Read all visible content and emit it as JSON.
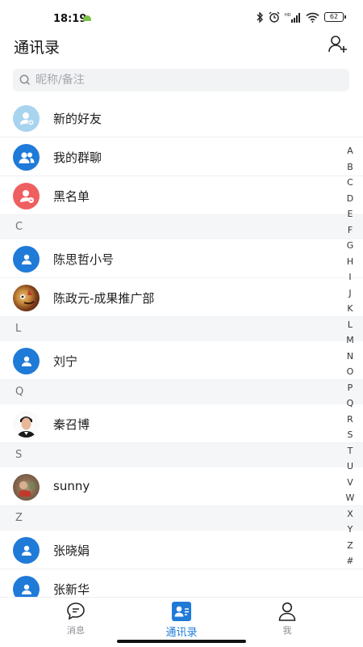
{
  "status_bar": {
    "time": "18:19",
    "battery": "62"
  },
  "header": {
    "title": "通讯录"
  },
  "search": {
    "placeholder": "昵称/备注"
  },
  "quick_entries": [
    {
      "label": "新的好友",
      "icon": "new-friend-icon"
    },
    {
      "label": "我的群聊",
      "icon": "group-chat-icon"
    },
    {
      "label": "黑名单",
      "icon": "blacklist-icon"
    }
  ],
  "sections": [
    {
      "letter": "C",
      "contacts": [
        "陈思哲小号",
        "陈政元-成果推广部"
      ]
    },
    {
      "letter": "L",
      "contacts": [
        "刘宁"
      ]
    },
    {
      "letter": "Q",
      "contacts": [
        "秦召博"
      ]
    },
    {
      "letter": "S",
      "contacts": [
        "sunny"
      ]
    },
    {
      "letter": "Z",
      "contacts": [
        "张晓娟",
        "张新华"
      ]
    }
  ],
  "index": [
    "A",
    "B",
    "C",
    "D",
    "E",
    "F",
    "G",
    "H",
    "I",
    "J",
    "K",
    "L",
    "M",
    "N",
    "O",
    "P",
    "Q",
    "R",
    "S",
    "T",
    "U",
    "V",
    "W",
    "X",
    "Y",
    "Z",
    "#"
  ],
  "tabs": [
    {
      "label": "消息",
      "icon": "chat-bubble-icon"
    },
    {
      "label": "通讯录",
      "icon": "contacts-icon",
      "active": true
    },
    {
      "label": "我",
      "icon": "person-icon"
    }
  ],
  "colors": {
    "accent": "#1f7ad8",
    "danger": "#ef5f5f",
    "light_blue": "#a9d4ef"
  }
}
